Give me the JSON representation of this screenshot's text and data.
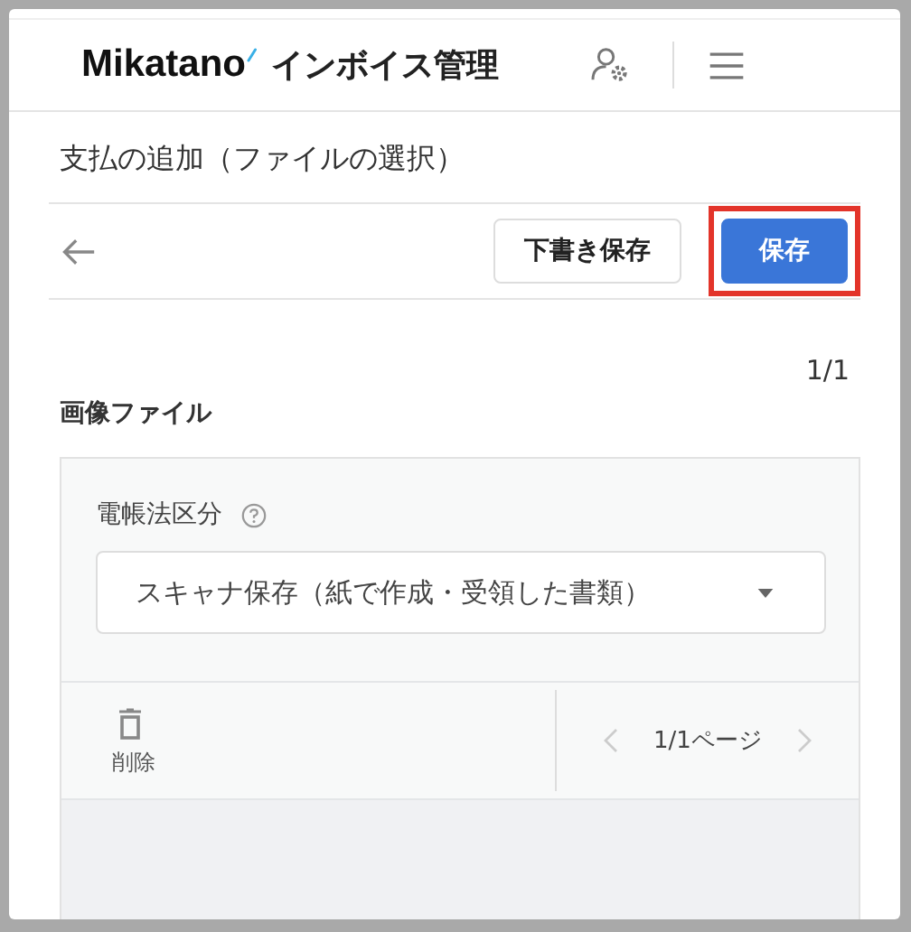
{
  "header": {
    "logo": "Mikatano",
    "app_name": "インボイス管理"
  },
  "page_title": "支払の追加（ファイルの選択）",
  "toolbar": {
    "buttons": [
      {
        "label": "下書き保存",
        "kind": "secondary",
        "highlighted": false
      },
      {
        "label": "保存",
        "kind": "primary",
        "highlighted": true
      }
    ]
  },
  "file_counter": "1/1",
  "section_title": "画像ファイル",
  "field": {
    "label": "電帳法区分",
    "value": "スキャナ保存（紙で作成・受領した書類）"
  },
  "file_actions": {
    "delete_label": "削除",
    "page_indicator": "1/1ページ"
  }
}
